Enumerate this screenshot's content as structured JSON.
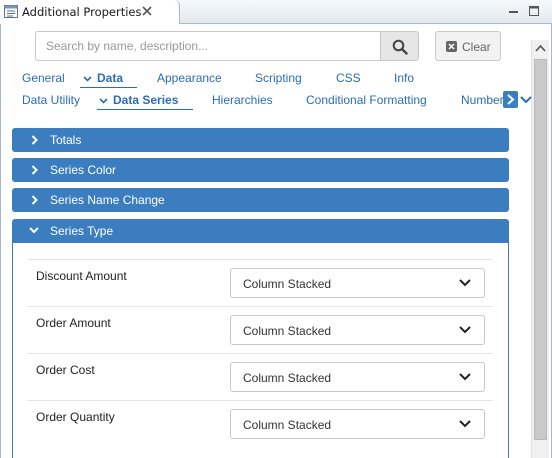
{
  "window": {
    "title": "Additional Properties"
  },
  "search": {
    "placeholder": "Search by name, description...",
    "value": "",
    "clear_label": "Clear"
  },
  "tabs_row1": [
    {
      "label": "General",
      "active": false
    },
    {
      "label": "Data",
      "active": true
    },
    {
      "label": "Appearance",
      "active": false
    },
    {
      "label": "Scripting",
      "active": false
    },
    {
      "label": "CSS",
      "active": false
    },
    {
      "label": "Info",
      "active": false
    }
  ],
  "tabs_row2": [
    {
      "label": "Data Utility",
      "active": false
    },
    {
      "label": "Data Series",
      "active": true
    },
    {
      "label": "Hierarchies",
      "active": false
    },
    {
      "label": "Conditional Formatting",
      "active": false
    },
    {
      "label": "Number",
      "active": false
    }
  ],
  "sections": [
    {
      "label": "Totals",
      "expanded": false
    },
    {
      "label": "Series Color",
      "expanded": false
    },
    {
      "label": "Series Name Change",
      "expanded": false
    },
    {
      "label": "Series Type",
      "expanded": true
    }
  ],
  "series_type_rows": [
    {
      "label": "Discount Amount",
      "value": "Column Stacked"
    },
    {
      "label": "Order Amount",
      "value": "Column Stacked"
    },
    {
      "label": "Order Cost",
      "value": "Column Stacked"
    },
    {
      "label": "Order Quantity",
      "value": "Column Stacked"
    }
  ],
  "colors": {
    "accent": "#3b7dbf",
    "link": "#2a6db5"
  }
}
